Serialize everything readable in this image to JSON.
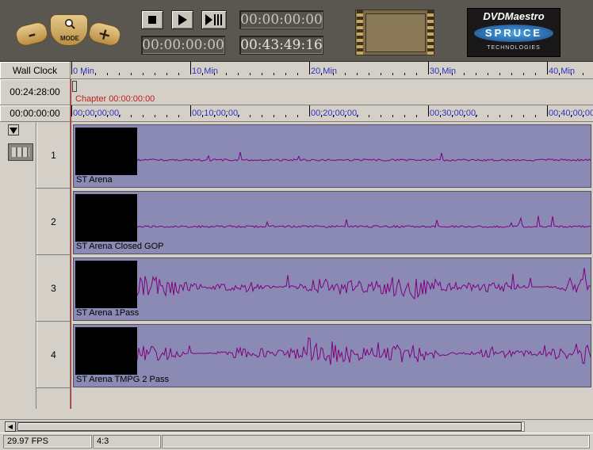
{
  "toolbar": {
    "zoom_out_label": "–",
    "zoom_in_label": "+",
    "mode_label": "MODE",
    "timecode_current": "00:00:00:00",
    "timecode_in": "00:00:00:00",
    "timecode_duration": "00:43:49:16"
  },
  "logo": {
    "title": "DVDMaestro",
    "brand": "SPRUCE",
    "subtitle": "TECHNOLOGIES"
  },
  "timeline": {
    "wall_clock_label": "Wall Clock",
    "wall_clock_time": "00:24:28:00",
    "timecode_origin": "00:00:00:00",
    "minute_labels": [
      "0 Min",
      "10 Min",
      "20 Min",
      "30 Min",
      "40 Min"
    ],
    "timecode_labels": [
      "00:00;00:00,",
      "00:10;00:00,",
      "00:20;00:00,",
      "00:30;00:00,",
      "00:40;00:00,"
    ],
    "chapter_label": "Chapter 00:00:00:00"
  },
  "tracks": [
    {
      "number": "1",
      "name": "ST Arena",
      "amplitude": "low"
    },
    {
      "number": "2",
      "name": "ST Arena Closed GOP",
      "amplitude": "low"
    },
    {
      "number": "3",
      "name": "ST Arena 1Pass",
      "amplitude": "high"
    },
    {
      "number": "4",
      "name": "ST Arena TMPG 2 Pass",
      "amplitude": "high"
    }
  ],
  "status": {
    "fps": "29.97 FPS",
    "aspect": "4:3",
    "extra": ""
  },
  "colors": {
    "track_bg": "#8a8ab4",
    "waveform": "#800080",
    "ruler_text": "#3030c0",
    "chapter_text": "#c02020",
    "playhead": "#c02020"
  }
}
